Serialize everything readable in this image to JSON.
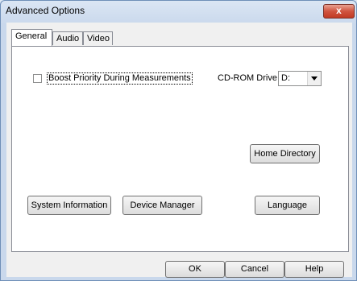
{
  "window": {
    "title": "Advanced Options",
    "close_label": "x"
  },
  "tabs": [
    {
      "label": "General",
      "active": true
    },
    {
      "label": "Audio",
      "active": false
    },
    {
      "label": "Video",
      "active": false
    }
  ],
  "general": {
    "boost_checkbox": {
      "label": "Boost Priority During Measurements",
      "checked": false
    },
    "cdrom": {
      "label": "CD-ROM Drive:",
      "value": "D:"
    },
    "buttons": {
      "home_directory": "Home Directory",
      "system_information": "System Information",
      "device_manager": "Device Manager",
      "language": "Language"
    }
  },
  "footer": {
    "ok": "OK",
    "cancel": "Cancel",
    "help": "Help"
  }
}
